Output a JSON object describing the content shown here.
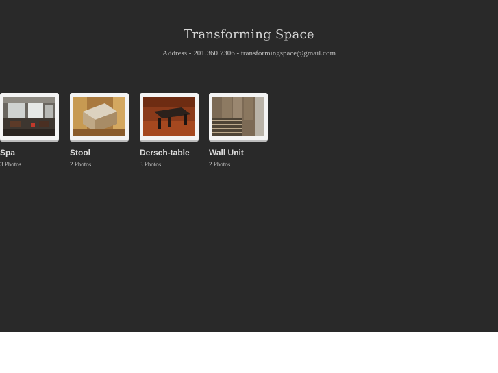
{
  "site": {
    "title": "Transforming Space",
    "contact": "Address - 201.360.7306 - transformingspace@gmail.com"
  },
  "albums": [
    {
      "title": "Spa",
      "count": "3 Photos",
      "thumb": "spa-interior-photo"
    },
    {
      "title": "Stool",
      "count": "2 Photos",
      "thumb": "wooden-stool-photo"
    },
    {
      "title": "Dersch-table",
      "count": "3 Photos",
      "thumb": "table-photo"
    },
    {
      "title": "Wall Unit",
      "count": "2 Photos",
      "thumb": "wall-unit-photo"
    }
  ],
  "colors": {
    "background": "#292929",
    "title_text": "#d6d6d6",
    "thumb_frame": "#f4f4f4"
  }
}
